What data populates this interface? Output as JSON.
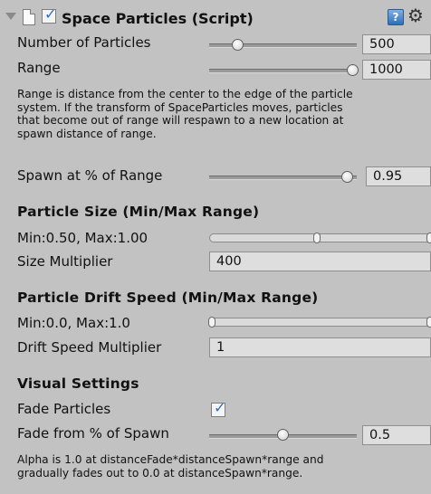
{
  "component": {
    "title": "Space Particles (Script)",
    "enabled": true,
    "icons": {
      "foldout": "foldout-triangle-icon",
      "script": "script-icon",
      "help": "help-book-icon",
      "settings": "gear-icon"
    }
  },
  "fields": {
    "number_of_particles": {
      "label": "Number of Particles",
      "value": "500",
      "slider_fraction": 0.2
    },
    "range": {
      "label": "Range",
      "value": "1000",
      "slider_fraction": 1.0
    },
    "range_note": [
      "Range is distance from the center to the edge of the particle",
      "system. If the transform of SpaceParticles moves, particles",
      "that become out of range will respawn to a new location at",
      "spawn distance of range."
    ],
    "spawn_at_range": {
      "label": "Spawn at % of Range",
      "value": "0.95",
      "slider_fraction": 0.95
    }
  },
  "particle_size": {
    "heading": "Particle Size (Min/Max Range)",
    "range_label": "Min:0.50, Max:1.00",
    "min_fraction": 0.5,
    "max_fraction": 1.0,
    "multiplier_label": "Size Multiplier",
    "multiplier_value": "400"
  },
  "drift_speed": {
    "heading": "Particle Drift Speed (Min/Max Range)",
    "range_label": "Min:0.0, Max:1.0",
    "min_fraction": 0.0,
    "max_fraction": 1.0,
    "multiplier_label": "Drift Speed Multiplier",
    "multiplier_value": "1"
  },
  "visual": {
    "heading": "Visual Settings",
    "fade_particles_label": "Fade Particles",
    "fade_particles_checked": true,
    "fade_from_label": "Fade from % of Spawn",
    "fade_from_value": "0.5",
    "fade_from_fraction": 0.5,
    "note": [
      "Alpha is 1.0 at distanceFade*distanceSpawn*range and",
      "gradually fades out to 0.0 at distanceSpawn*range."
    ]
  },
  "colors": {
    "background": "#c2c2c2",
    "check_accent": "#2f6ec0"
  }
}
